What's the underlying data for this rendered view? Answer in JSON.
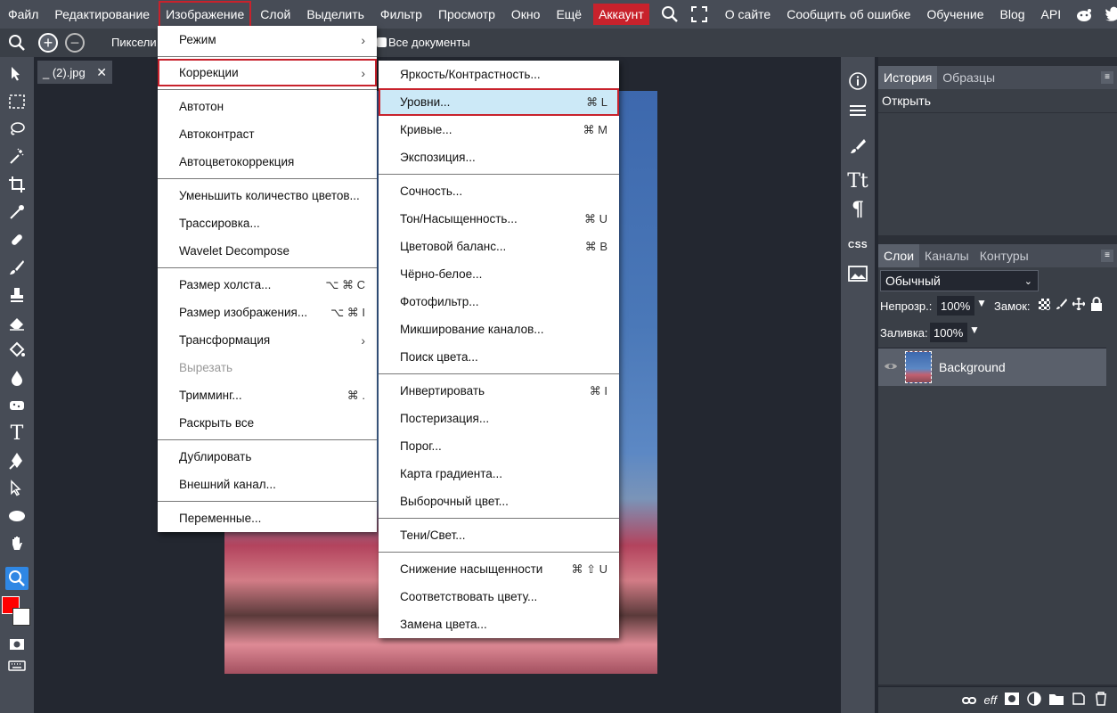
{
  "menubar": {
    "file": "Файл",
    "edit": "Редактирование",
    "image": "Изображение",
    "layer": "Слой",
    "select": "Выделить",
    "filter": "Фильтр",
    "view": "Просмотр",
    "window": "Окно",
    "more": "Ещё",
    "account": "Аккаунт",
    "about": "О сайте",
    "report": "Сообщить об ошибке",
    "learn": "Обучение",
    "blog": "Blog",
    "api": "API"
  },
  "options": {
    "pixels": "Пиксели",
    "all_docs": "Все документы"
  },
  "doc": {
    "tab": "_ (2).jpg",
    "close": "✕"
  },
  "image_menu": {
    "mode": "Режим",
    "adjustments": "Коррекции",
    "autotone": "Автотон",
    "autocontrast": "Автоконтраст",
    "autocolor": "Автоцветокоррекция",
    "reduce": "Уменьшить количество цветов...",
    "trace": "Трассировка...",
    "wavelet": "Wavelet Decompose",
    "canvas_size": "Размер холста...",
    "canvas_size_sc": "⌥ ⌘ C",
    "image_size": "Размер изображения...",
    "image_size_sc": "⌥ ⌘ I",
    "transform": "Трансформация",
    "crop": "Вырезать",
    "trim": "Тримминг...",
    "trim_sc": "⌘ .",
    "reveal": "Раскрыть все",
    "duplicate": "Дублировать",
    "external": "Внешний канал...",
    "variables": "Переменные..."
  },
  "adj_menu": {
    "brightness": "Яркость/Контрастность...",
    "levels": "Уровни...",
    "levels_sc": "⌘ L",
    "curves": "Кривые...",
    "curves_sc": "⌘ M",
    "exposure": "Экспозиция...",
    "vibrance": "Сочность...",
    "hue": "Тон/Насыщенность...",
    "hue_sc": "⌘ U",
    "balance": "Цветовой баланс...",
    "balance_sc": "⌘ B",
    "bw": "Чёрно-белое...",
    "photofilter": "Фотофильтр...",
    "mixer": "Микширование каналов...",
    "lookup": "Поиск цвета...",
    "invert": "Инвертировать",
    "invert_sc": "⌘ I",
    "posterize": "Постеризация...",
    "threshold": "Порог...",
    "gradmap": "Карта градиента...",
    "selective": "Выборочный цвет...",
    "shadows": "Тени/Свет...",
    "desaturate": "Снижение насыщенности",
    "desaturate_sc": "⌘ ⇧ U",
    "match": "Соответствовать цвету...",
    "replace": "Замена цвета..."
  },
  "history": {
    "tab1": "История",
    "tab2": "Образцы",
    "item": "Открыть"
  },
  "layers": {
    "tab1": "Слои",
    "tab2": "Каналы",
    "tab3": "Контуры",
    "blend": "Обычный",
    "opacity_label": "Непрозр.:",
    "opacity": "100%",
    "lock_label": "Замок:",
    "fill_label": "Заливка:",
    "fill": "100%",
    "layer_name": "Background"
  },
  "icons": {
    "css": "CSS"
  },
  "colors": {
    "accent": "#c8222c",
    "highlight": "#cce9f7",
    "fg": "#ff0000",
    "bg": "#ffffff"
  }
}
